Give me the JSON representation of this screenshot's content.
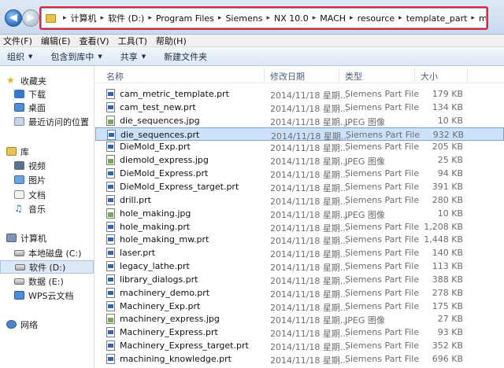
{
  "address": {
    "crumbs": [
      "计算机",
      "软件 (D:)",
      "Program Files",
      "Siemens",
      "NX 10.0",
      "MACH",
      "resource",
      "template_part",
      "metric"
    ]
  },
  "menu": [
    "文件(F)",
    "编辑(E)",
    "查看(V)",
    "工具(T)",
    "帮助(H)"
  ],
  "commands": {
    "organize": "组织",
    "include_library": "包含到库中",
    "share": "共享",
    "new_folder": "新建文件夹"
  },
  "nav": {
    "favorites": "收藏夹",
    "downloads": "下载",
    "desktop": "桌面",
    "recent": "最近访问的位置",
    "libraries": "库",
    "videos": "视频",
    "pictures": "图片",
    "documents": "文档",
    "music": "音乐",
    "computer": "计算机",
    "drive_c": "本地磁盘 (C:)",
    "drive_d": "软件 (D:)",
    "drive_e": "数据 (E:)",
    "wps": "WPS云文档",
    "network": "网络"
  },
  "columns": {
    "name": "名称",
    "date": "修改日期",
    "type": "类型",
    "size": "大小"
  },
  "files": [
    {
      "name": "cam_metric_template.prt",
      "date": "2014/11/18 星期...",
      "type": "Siemens Part File",
      "size": "179 KB",
      "kind": "prt"
    },
    {
      "name": "cam_test_new.prt",
      "date": "2014/11/18 星期...",
      "type": "Siemens Part File",
      "size": "134 KB",
      "kind": "prt"
    },
    {
      "name": "die_sequences.jpg",
      "date": "2014/11/18 星期...",
      "type": "JPEG 图像",
      "size": "10 KB",
      "kind": "jpg"
    },
    {
      "name": "die_sequences.prt",
      "date": "2014/11/18 星期...",
      "type": "Siemens Part File",
      "size": "932 KB",
      "kind": "prt",
      "selected": true
    },
    {
      "name": "DieMold_Exp.prt",
      "date": "2014/11/18 星期...",
      "type": "Siemens Part File",
      "size": "205 KB",
      "kind": "prt"
    },
    {
      "name": "diemold_express.jpg",
      "date": "2014/11/18 星期...",
      "type": "JPEG 图像",
      "size": "25 KB",
      "kind": "jpg"
    },
    {
      "name": "DieMold_Express.prt",
      "date": "2014/11/18 星期...",
      "type": "Siemens Part File",
      "size": "94 KB",
      "kind": "prt"
    },
    {
      "name": "DieMold_Express_target.prt",
      "date": "2014/11/18 星期...",
      "type": "Siemens Part File",
      "size": "391 KB",
      "kind": "prt"
    },
    {
      "name": "drill.prt",
      "date": "2014/11/18 星期...",
      "type": "Siemens Part File",
      "size": "280 KB",
      "kind": "prt"
    },
    {
      "name": "hole_making.jpg",
      "date": "2014/11/18 星期...",
      "type": "JPEG 图像",
      "size": "10 KB",
      "kind": "jpg"
    },
    {
      "name": "hole_making.prt",
      "date": "2014/11/18 星期...",
      "type": "Siemens Part File",
      "size": "1,208 KB",
      "kind": "prt"
    },
    {
      "name": "hole_making_mw.prt",
      "date": "2014/11/18 星期...",
      "type": "Siemens Part File",
      "size": "1,448 KB",
      "kind": "prt"
    },
    {
      "name": "laser.prt",
      "date": "2014/11/18 星期...",
      "type": "Siemens Part File",
      "size": "140 KB",
      "kind": "prt"
    },
    {
      "name": "legacy_lathe.prt",
      "date": "2014/11/18 星期...",
      "type": "Siemens Part File",
      "size": "113 KB",
      "kind": "prt"
    },
    {
      "name": "library_dialogs.prt",
      "date": "2014/11/18 星期...",
      "type": "Siemens Part File",
      "size": "388 KB",
      "kind": "prt"
    },
    {
      "name": "machinery_demo.prt",
      "date": "2014/11/18 星期...",
      "type": "Siemens Part File",
      "size": "278 KB",
      "kind": "prt"
    },
    {
      "name": "Machinery_Exp.prt",
      "date": "2014/11/18 星期...",
      "type": "Siemens Part File",
      "size": "175 KB",
      "kind": "prt"
    },
    {
      "name": "machinery_express.jpg",
      "date": "2014/11/18 星期...",
      "type": "JPEG 图像",
      "size": "27 KB",
      "kind": "jpg"
    },
    {
      "name": "Machinery_Express.prt",
      "date": "2014/11/18 星期...",
      "type": "Siemens Part File",
      "size": "93 KB",
      "kind": "prt"
    },
    {
      "name": "Machinery_Express_target.prt",
      "date": "2014/11/18 星期...",
      "type": "Siemens Part File",
      "size": "352 KB",
      "kind": "prt"
    },
    {
      "name": "machining_knowledge.prt",
      "date": "2014/11/18 星期...",
      "type": "Siemens Part File",
      "size": "696 KB",
      "kind": "prt"
    }
  ],
  "colors": {
    "highlight_border": "#e0283a",
    "selected_row": "#cce2fa",
    "header_text": "#4c607a"
  }
}
